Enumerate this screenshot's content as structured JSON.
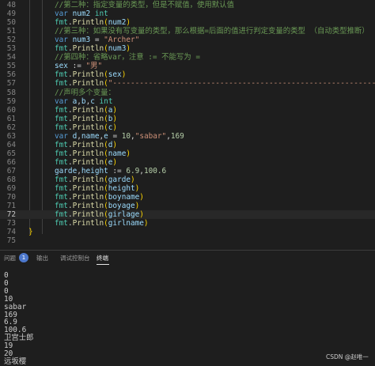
{
  "editor": {
    "lines": [
      {
        "no": "48",
        "html": "<span class=\"cm\">//第二种：指定变量的类型，但是不赋值，使用默认值</span>"
      },
      {
        "no": "49",
        "html": "<span class=\"kw\">var</span> <span class=\"var\">num2</span> <span class=\"ty\">int</span>"
      },
      {
        "no": "50",
        "html": "<span class=\"ty\">fmt</span>.<span class=\"fn\">Println</span><span class=\"br1\">(</span><span class=\"var\">num2</span><span class=\"br1\">)</span>"
      },
      {
        "no": "51",
        "html": "<span class=\"cm\">//第三种：如果没有写变量的类型，那么根据=后面的值进行判定变量的类型 （自动类型推断）</span>"
      },
      {
        "no": "52",
        "html": "<span class=\"kw\">var</span> <span class=\"var\">num3</span> = <span class=\"str\">\"Archer\"</span>"
      },
      {
        "no": "53",
        "html": "<span class=\"ty\">fmt</span>.<span class=\"fn\">Println</span><span class=\"br1\">(</span><span class=\"var\">num3</span><span class=\"br1\">)</span>"
      },
      {
        "no": "54",
        "html": "<span class=\"cm\">//第四种：省略var，注意 := 不能写为 =</span>"
      },
      {
        "no": "55",
        "html": "<span class=\"var\">sex</span> := <span class=\"str\">\"男\"</span>"
      },
      {
        "no": "56",
        "html": "<span class=\"ty\">fmt</span>.<span class=\"fn\">Println</span><span class=\"br1\">(</span><span class=\"var\">sex</span><span class=\"br1\">)</span>"
      },
      {
        "no": "57",
        "html": "<span class=\"ty\">fmt</span>.<span class=\"fn\">Println</span><span class=\"br1\">(</span><span class=\"str\">\"----------------------------------------------------------------\"</span><span class=\"br1\">)</span>"
      },
      {
        "no": "58",
        "html": "<span class=\"cm\">//声明多个变量：</span>"
      },
      {
        "no": "59",
        "html": "<span class=\"kw\">var</span> <span class=\"var\">a</span>,<span class=\"var\">b</span>,<span class=\"var\">c</span> <span class=\"ty\">int</span>"
      },
      {
        "no": "60",
        "html": "<span class=\"ty\">fmt</span>.<span class=\"fn\">Println</span><span class=\"br1\">(</span><span class=\"var\">a</span><span class=\"br1\">)</span>"
      },
      {
        "no": "61",
        "html": "<span class=\"ty\">fmt</span>.<span class=\"fn\">Println</span><span class=\"br1\">(</span><span class=\"var\">b</span><span class=\"br1\">)</span>"
      },
      {
        "no": "62",
        "html": "<span class=\"ty\">fmt</span>.<span class=\"fn\">Println</span><span class=\"br1\">(</span><span class=\"var\">c</span><span class=\"br1\">)</span>"
      },
      {
        "no": "63",
        "html": "<span class=\"kw\">var</span> <span class=\"var\">d</span>,<span class=\"var\">name</span>,<span class=\"var\">e</span> = <span class=\"num\">10</span>,<span class=\"str\">\"sabar\"</span>,<span class=\"num\">169</span>"
      },
      {
        "no": "64",
        "html": "<span class=\"ty\">fmt</span>.<span class=\"fn\">Println</span><span class=\"br1\">(</span><span class=\"var\">d</span><span class=\"br1\">)</span>"
      },
      {
        "no": "65",
        "html": "<span class=\"ty\">fmt</span>.<span class=\"fn\">Println</span><span class=\"br1\">(</span><span class=\"var\">name</span><span class=\"br1\">)</span>"
      },
      {
        "no": "66",
        "html": "<span class=\"ty\">fmt</span>.<span class=\"fn\">Println</span><span class=\"br1\">(</span><span class=\"var\">e</span><span class=\"br1\">)</span>"
      },
      {
        "no": "67",
        "html": "<span class=\"var\">garde</span>,<span class=\"var\">height</span> := <span class=\"num\">6.9</span>,<span class=\"num\">100.6</span>"
      },
      {
        "no": "68",
        "html": "<span class=\"ty\">fmt</span>.<span class=\"fn\">Println</span><span class=\"br1\">(</span><span class=\"var\">garde</span><span class=\"br1\">)</span>"
      },
      {
        "no": "69",
        "html": "<span class=\"ty\">fmt</span>.<span class=\"fn\">Println</span><span class=\"br1\">(</span><span class=\"var\">height</span><span class=\"br1\">)</span>"
      },
      {
        "no": "70",
        "html": "<span class=\"ty\">fmt</span>.<span class=\"fn\">Println</span><span class=\"br1\">(</span><span class=\"var\">boyname</span><span class=\"br1\">)</span>"
      },
      {
        "no": "71",
        "html": "<span class=\"ty\">fmt</span>.<span class=\"fn\">Println</span><span class=\"br1\">(</span><span class=\"var\">boyage</span><span class=\"br1\">)</span>"
      },
      {
        "no": "72",
        "html": "<span class=\"ty\">fmt</span>.<span class=\"fn\">Println</span><span class=\"br1\">(</span><span class=\"var\">girlage</span><span class=\"br1\">)</span>"
      },
      {
        "no": "73",
        "html": "<span class=\"ty\">fmt</span>.<span class=\"fn\">Println</span><span class=\"br1\">(</span><span class=\"var\">girlname</span><span class=\"br1\">)</span>"
      },
      {
        "no": "74",
        "html": "<span class=\"br1\">}</span>"
      },
      {
        "no": "75",
        "html": ""
      }
    ],
    "current_line": "72"
  },
  "panel": {
    "tabs": [
      "问题",
      "输出",
      "调试控制台",
      "终端"
    ],
    "active_tab": "终端",
    "problems_count": "1"
  },
  "terminal": {
    "output_lines": [
      "0",
      "0",
      "0",
      "10",
      "sabar",
      "169",
      "6.9",
      "100.6",
      "卫宫士郎",
      "19",
      "20",
      "远坂樱"
    ]
  },
  "watermark": "CSDN @赵唯一",
  "colors": {
    "background": "#1e1e1e",
    "keyword": "#569cd6",
    "type": "#4ec9b0",
    "function": "#dcdcaa",
    "string": "#ce9178",
    "number": "#b5cea8",
    "comment": "#6a9955",
    "variable": "#9cdcfe",
    "bracket": "#ffd700",
    "badge": "#4d78cc"
  }
}
